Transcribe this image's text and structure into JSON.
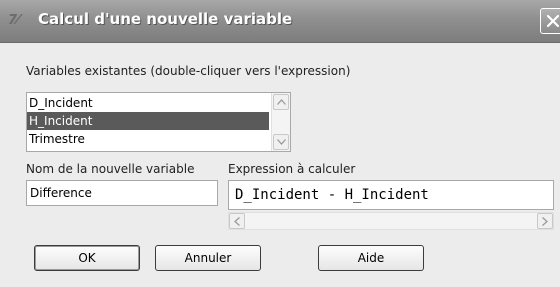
{
  "window": {
    "title": "Calcul d'une nouvelle variable",
    "icon_text": "7⁄"
  },
  "existing": {
    "label": "Variables existantes (double-cliquer vers l'expression)",
    "items": [
      {
        "label": "D_Incident",
        "selected": false
      },
      {
        "label": "H_Incident",
        "selected": true
      },
      {
        "label": "Trimestre",
        "selected": false
      }
    ]
  },
  "new_var": {
    "label": "Nom de la nouvelle variable",
    "value": "Difference"
  },
  "expression": {
    "label": "Expression à calculer",
    "value": "D_Incident - H_Incident"
  },
  "buttons": {
    "ok": "OK",
    "cancel": "Annuler",
    "help": "Aide"
  },
  "icons": [
    "close-icon",
    "scroll-up-icon",
    "scroll-down-icon",
    "scroll-left-icon",
    "scroll-right-icon"
  ]
}
